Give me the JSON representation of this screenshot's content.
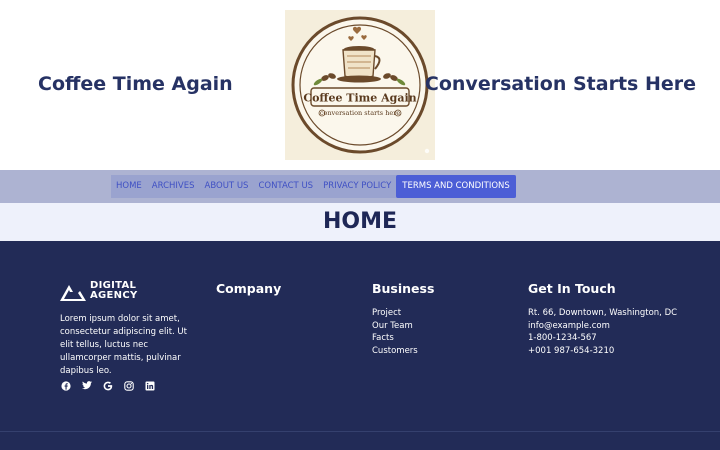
{
  "header": {
    "left_title": "Coffee Time Again",
    "right_title": "Conversation Starts Here",
    "logo": {
      "title": "Coffee Time Again",
      "tagline": "conversation starts here"
    }
  },
  "nav": {
    "items": [
      {
        "label": "HOME"
      },
      {
        "label": "ARCHIVES"
      },
      {
        "label": "ABOUT US"
      },
      {
        "label": "CONTACT US"
      },
      {
        "label": "PRIVACY POLICY"
      },
      {
        "label": "TERMS AND CONDITIONS"
      }
    ],
    "active_index": 5
  },
  "page": {
    "title": "HOME"
  },
  "footer": {
    "brand": {
      "line1": "DIGITAL",
      "line2": "AGENCY"
    },
    "about": "Lorem ipsum dolor sit amet, consectetur adipiscing elit. Ut elit tellus, luctus nec ullamcorper mattis, pulvinar dapibus leo.",
    "social_icons": [
      "facebook-icon",
      "twitter-icon",
      "google-icon",
      "instagram-icon",
      "linkedin-icon"
    ],
    "company": {
      "title": "Company"
    },
    "business": {
      "title": "Business",
      "links": [
        "Project",
        "Our Team",
        "Facts",
        "Customers"
      ]
    },
    "contact": {
      "title": "Get In Touch",
      "lines": [
        "Rt. 66, Downtown, Washington, DC",
        "info@example.com",
        "1-800-1234-567",
        "+001 987-654-3210"
      ]
    }
  },
  "colors": {
    "heading": "#263264",
    "nav_bar": "#adb3d2",
    "nav_active": "#4c5ed6",
    "nav_link": "#3f50c4",
    "title_band": "#eef1fb",
    "footer_bg": "#222b57",
    "logo_brown": "#6b4a2b",
    "logo_bg": "#f5eedc"
  }
}
